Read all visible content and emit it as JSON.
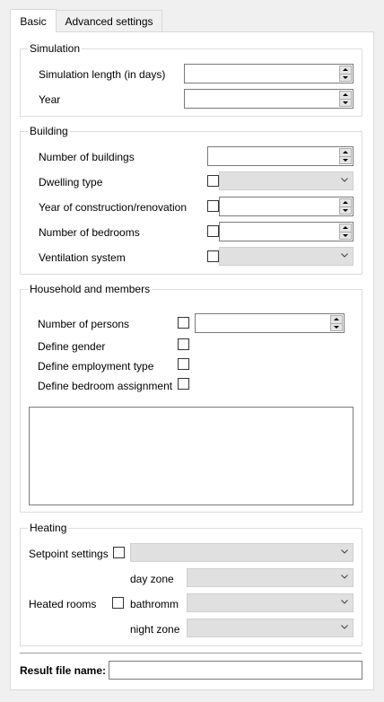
{
  "tabs": [
    {
      "label": "Basic"
    },
    {
      "label": "Advanced settings"
    }
  ],
  "simulation": {
    "title": "Simulation",
    "length_label": "Simulation length (in days)",
    "length_value": "",
    "year_label": "Year",
    "year_value": ""
  },
  "building": {
    "title": "Building",
    "num_buildings_label": "Number of buildings",
    "num_buildings_value": "",
    "dwelling_type_label": "Dwelling type",
    "dwelling_type_value": "",
    "year_construction_label": "Year of construction/renovation",
    "year_construction_value": "",
    "num_bedrooms_label": "Number of bedrooms",
    "num_bedrooms_value": "",
    "ventilation_label": "Ventilation system",
    "ventilation_value": ""
  },
  "household": {
    "title": "Household and members",
    "num_persons_label": "Number of persons",
    "num_persons_value": "",
    "define_gender_label": "Define gender",
    "define_employment_label": "Define employment type",
    "define_bedroom_label": "Define bedroom assignment"
  },
  "heating": {
    "title": "Heating",
    "setpoint_label": "Setpoint settings",
    "setpoint_value": "",
    "heated_rooms_label": "Heated rooms",
    "day_zone_label": "day zone",
    "bathroom_label": "bathromm",
    "night_zone_label": "night zone"
  },
  "result": {
    "label": "Result file name:",
    "value": ""
  }
}
